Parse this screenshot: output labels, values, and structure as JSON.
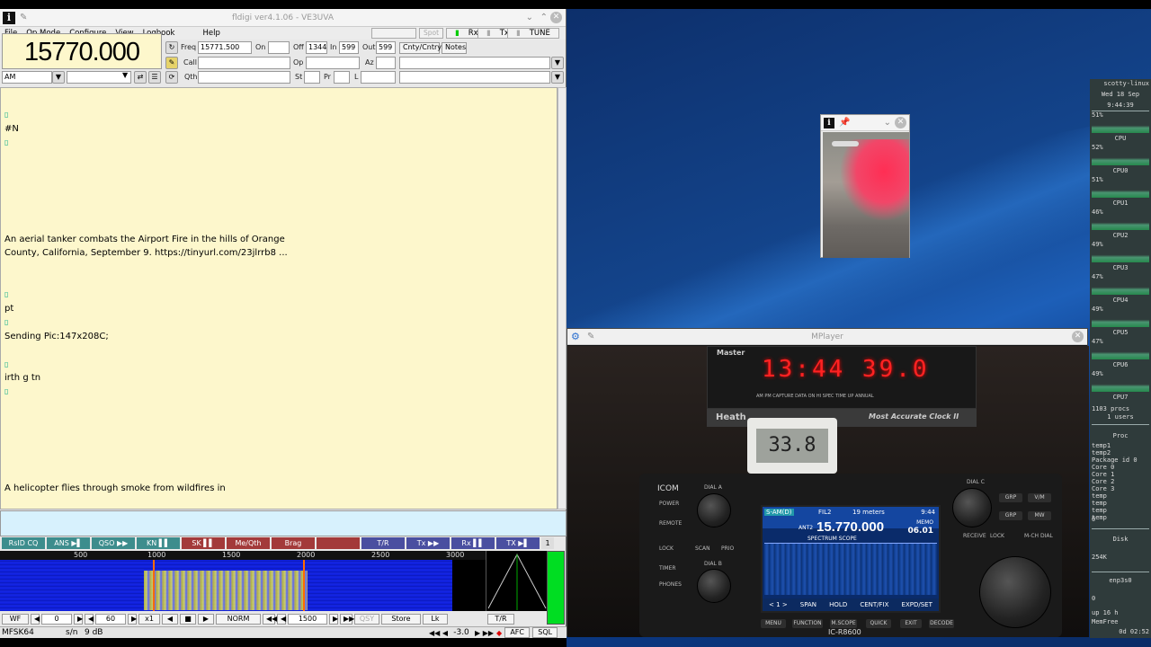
{
  "fldigi": {
    "title": "fldigi ver4.1.06 - VE3UVA",
    "menu": [
      "File",
      "Op Mode",
      "Configure",
      "View",
      "Logbook",
      "Help"
    ],
    "top_buttons": [
      "Spot",
      "RxID",
      "TxID",
      "TUNE"
    ],
    "frequency_display": "15770.000",
    "mode": "AM",
    "fields": {
      "freq_label": "Freq",
      "freq_value": "15771.500",
      "on_label": "On",
      "on_value": "",
      "off_label": "Off",
      "off_value": "1344",
      "in_label": "In",
      "in_value": "599",
      "out_label": "Out",
      "out_value": "599",
      "cnty_label": "Cnty/Cntry",
      "notes_label": "Notes",
      "call_label": "Call",
      "op_label": "Op",
      "az_label": "Az",
      "qth_label": "Qth",
      "st_label": "St",
      "pr_label": "Pr",
      "l_label": "L"
    },
    "rx_text": [
      {
        "text": "▯",
        "glyph": true
      },
      {
        "text": "#N",
        "glyph": false
      },
      {
        "text": "▯",
        "glyph": true
      },
      {
        "text": "An aerial tanker combats the Airport Fire in the hills of Orange",
        "glyph": false
      },
      {
        "text": "County, California, September 9. https://tinyurl.com/23jlrrb8 ...",
        "glyph": false
      },
      {
        "text": "▯",
        "glyph": true
      },
      {
        "text": "pt",
        "glyph": false
      },
      {
        "text": "▯",
        "glyph": true
      },
      {
        "text": "Sending Pic:147x208C;",
        "glyph": false
      },
      {
        "text": "▯",
        "glyph": true
      },
      {
        "text": "irth g tn",
        "glyph": false
      },
      {
        "text": "▯",
        "glyph": true
      },
      {
        "text": "A helicopter flies through smoke from wildfires in",
        "glyph": false
      }
    ],
    "macros": [
      {
        "label": "RsID CQ",
        "color": "#3d8d8d"
      },
      {
        "label": "ANS ▶▌",
        "color": "#3d8d8d"
      },
      {
        "label": "QSO ▶▶",
        "color": "#3d8d8d"
      },
      {
        "label": "KN ▌▌",
        "color": "#3d8d8d"
      },
      {
        "label": "SK ▌▌",
        "color": "#a33a3a"
      },
      {
        "label": "Me/Qth",
        "color": "#a33a3a"
      },
      {
        "label": "Brag",
        "color": "#a33a3a"
      },
      {
        "label": "",
        "color": "#a33a3a"
      },
      {
        "label": "T/R",
        "color": "#4a4fa0"
      },
      {
        "label": "Tx ▶▶",
        "color": "#4a4fa0"
      },
      {
        "label": "Rx ▌▌",
        "color": "#4a4fa0"
      },
      {
        "label": "TX ▶▌",
        "color": "#4a4fa0"
      },
      {
        "label": "1",
        "color": "#dddddd"
      }
    ],
    "wf_scale": [
      "500",
      "1000",
      "1500",
      "2000",
      "2500",
      "3000"
    ],
    "controls": [
      "WF",
      "◀",
      "0",
      "▶",
      "◀",
      "60",
      "▶",
      "x1",
      "◀",
      "■",
      "▶",
      "NORM",
      "◀◀",
      "◀",
      "1500",
      "▶",
      "▶▶",
      "QSY",
      "Store",
      "Lk",
      "T/R"
    ],
    "status": {
      "mode": "MFSK64",
      "sn": "s/n",
      "sn_val": "9 dB",
      "afc_val": "-3.0",
      "afc": "AFC",
      "sql": "SQL"
    }
  },
  "image_window": {
    "pinned": "📌"
  },
  "mplayer": {
    "title": "MPlayer",
    "clock": "13:44 39.0",
    "clock_brand": "Master",
    "clock_labels": "AM   PM   CAPTURE   DATA   ON   HI SPEC   TIME UP   ANNUAL",
    "heath": "Heath",
    "heath_slogan": "Most Accurate Clock II",
    "thermometer": "33.8",
    "radio": {
      "brand": "ICOM",
      "model": "IC-R8600",
      "mode": "S-AM(D)",
      "filter": "FIL2",
      "band": "19 meters",
      "ant": "ANT2",
      "freq": "15.770.000",
      "time": "9:44",
      "memo": "MEMO",
      "memo_ch": "06.01",
      "scope": "SPECTRUM SCOPE",
      "buttons": [
        "< 1 >",
        "SPAN",
        "HOLD",
        "CENT/FIX",
        "EXPD/SET"
      ],
      "labels": [
        "POWER",
        "REMOTE",
        "LOCK",
        "TIMER",
        "PHONES",
        "DIAL A",
        "DIAL B",
        "SCAN",
        "PRIO",
        "DIAL C",
        "RECEIVE",
        "LOCK",
        "M-CH DIAL",
        "GRP",
        "V/M",
        "GRP",
        "MW"
      ],
      "soft": [
        "MENU",
        "FUNCTION",
        "M.SCOPE",
        "QUICK",
        "EXIT",
        "DECODE"
      ]
    }
  },
  "conky": {
    "host": "scotty-linux",
    "date": "Wed 18 Sep",
    "time": "9:44:39",
    "cpus": [
      {
        "pct": "51%",
        "label": "CPU"
      },
      {
        "pct": "52%",
        "label": "CPU0"
      },
      {
        "pct": "51%",
        "label": "CPU1"
      },
      {
        "pct": "46%",
        "label": "CPU2"
      },
      {
        "pct": "49%",
        "label": "CPU3"
      },
      {
        "pct": "47%",
        "label": "CPU4"
      },
      {
        "pct": "49%",
        "label": "CPU5"
      },
      {
        "pct": "47%",
        "label": "CPU6"
      },
      {
        "pct": "49%",
        "label": "CPU7"
      }
    ],
    "procs": "1103 procs",
    "users": "1 users",
    "proc_header": "Proc",
    "temps": [
      "temp1",
      "temp2",
      "Package id 0",
      "Core 0",
      "Core 1",
      "Core 2",
      "Core 3",
      "temp",
      "temp",
      "temp",
      "temp"
    ],
    "temp_zero": "0",
    "disk_header": "Disk",
    "disk_val": "254K",
    "net": "enp3s0",
    "net_zero": "0",
    "up": "up 16 h",
    "mem": "MemFree",
    "uptime": "0d 02:52"
  }
}
